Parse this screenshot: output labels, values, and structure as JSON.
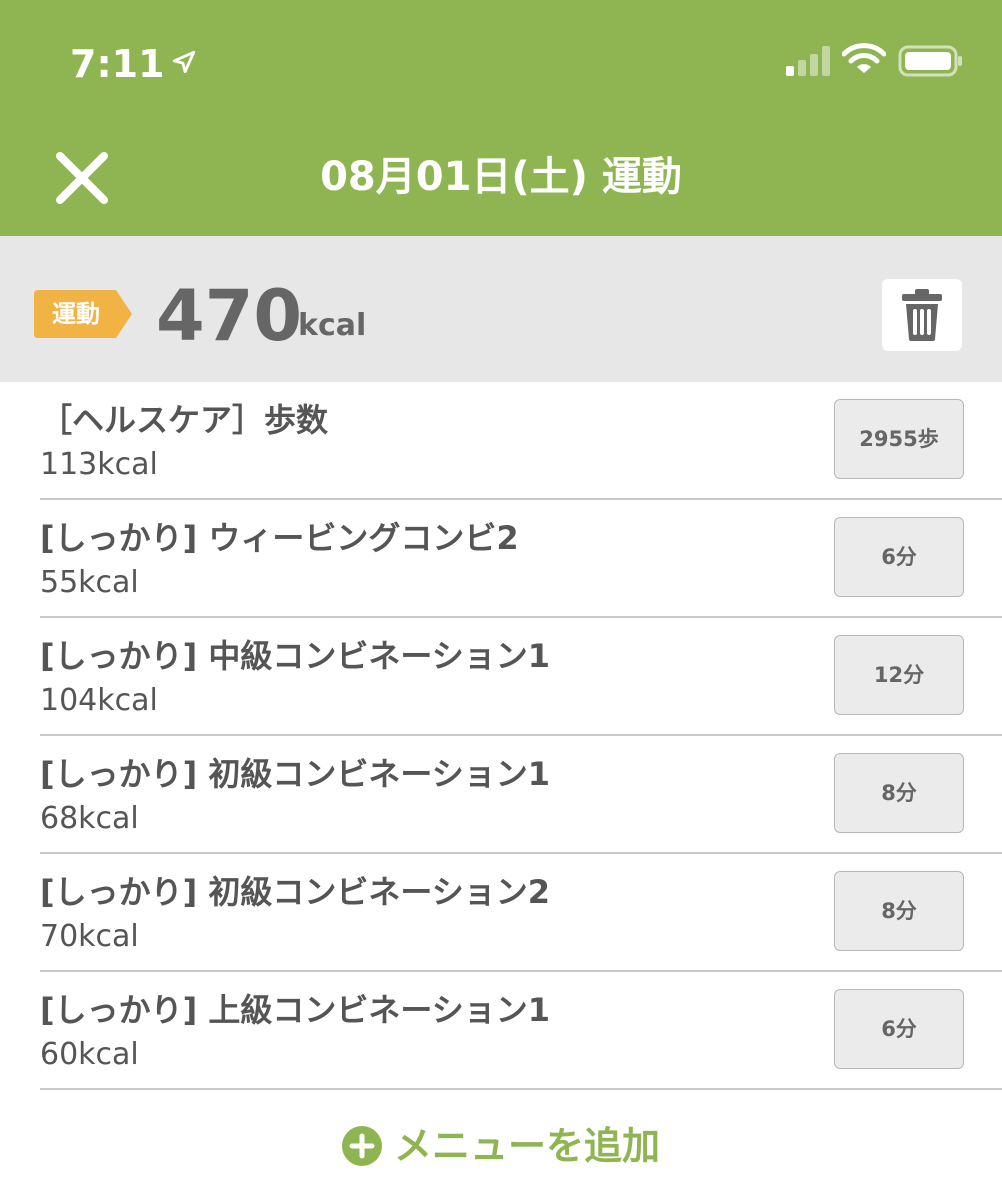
{
  "status_bar": {
    "time": "7:11"
  },
  "header": {
    "title": "08月01日(土) 運動"
  },
  "summary": {
    "tag": "運動",
    "total": "470",
    "unit": "kcal"
  },
  "items": [
    {
      "name": "［ヘルスケア］歩数",
      "kcal": "113kcal",
      "amount": "2955歩"
    },
    {
      "name": "[しっかり] ウィービングコンビ2",
      "kcal": "55kcal",
      "amount": "6分"
    },
    {
      "name": "[しっかり] 中級コンビネーション1",
      "kcal": "104kcal",
      "amount": "12分"
    },
    {
      "name": "[しっかり] 初級コンビネーション1",
      "kcal": "68kcal",
      "amount": "8分"
    },
    {
      "name": "[しっかり] 初級コンビネーション2",
      "kcal": "70kcal",
      "amount": "8分"
    },
    {
      "name": "[しっかり] 上級コンビネーション1",
      "kcal": "60kcal",
      "amount": "6分"
    }
  ],
  "add_menu": {
    "label": "メニューを追加"
  },
  "colors": {
    "header_green": "#8fb552",
    "tag_orange": "#f2b345",
    "summary_gray": "#e7e7e7",
    "text_gray": "#555555"
  },
  "icons": [
    "location-arrow-icon",
    "signal-icon",
    "wifi-icon",
    "battery-icon",
    "close-icon",
    "trash-icon",
    "plus-circle-icon"
  ]
}
